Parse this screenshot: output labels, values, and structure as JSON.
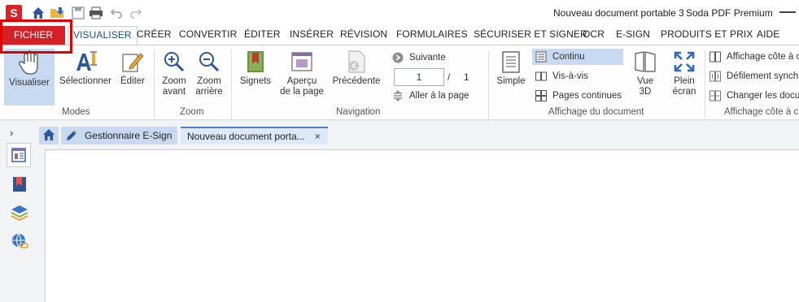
{
  "titlebar": {
    "app_logo": "S",
    "window_title": "Nouveau document portable 3",
    "brand": "Soda PDF Premium",
    "quick_access": [
      "home-icon",
      "open-folder-icon",
      "save-icon",
      "print-icon",
      "undo-icon",
      "redo-icon"
    ]
  },
  "tabs": {
    "file": "FICHIER",
    "items": [
      "VISUALISER",
      "CRÉER",
      "CONVERTIR",
      "ÉDITER",
      "INSÉRER",
      "RÉVISION",
      "FORMULAIRES",
      "SÉCURISER ET SIGNER",
      "OCR",
      "E-SIGN",
      "PRODUITS ET PRIX",
      "AIDE"
    ],
    "active": "VISUALISER"
  },
  "ribbon": {
    "modes": {
      "label": "Modes",
      "visualiser": "Visualiser",
      "selectionner": "Sélectionner",
      "editer": "Éditer"
    },
    "zoom": {
      "label": "Zoom",
      "zoom_in_1": "Zoom",
      "zoom_in_2": "avant",
      "zoom_out_1": "Zoom",
      "zoom_out_2": "arrière"
    },
    "navigation": {
      "label": "Navigation",
      "signets": "Signets",
      "apercu_1": "Aperçu",
      "apercu_2": "de la page",
      "precedente": "Précédente",
      "suivante": "Suivante",
      "page_value": "1",
      "page_separator": "/",
      "page_total": "1",
      "aller": "Aller à la page"
    },
    "affichage": {
      "label": "Affichage du document",
      "simple": "Simple",
      "continu": "Continu",
      "vis_a_vis": "Vis-à-vis",
      "pages_continues": "Pages continues",
      "vue3d_1": "Vue",
      "vue3d_2": "3D",
      "plein_1": "Plein",
      "plein_2": "écran"
    },
    "cote_a_cote": {
      "label": "Affichage côte à c",
      "affichage": "Affichage côte à c",
      "defilement": "Défilement synch",
      "changer": "Changer les docu"
    }
  },
  "docbar": {
    "esign_tab": "Gestionnaire E-Sign",
    "current_tab": "Nouveau document porta...",
    "close_glyph": "×",
    "expand_glyph": "›"
  },
  "colors": {
    "accent_red": "#d42127",
    "selection_blue": "#c8daf2",
    "tab_blue": "#c9d9ef",
    "active_tab_text": "#1e4f8a"
  }
}
